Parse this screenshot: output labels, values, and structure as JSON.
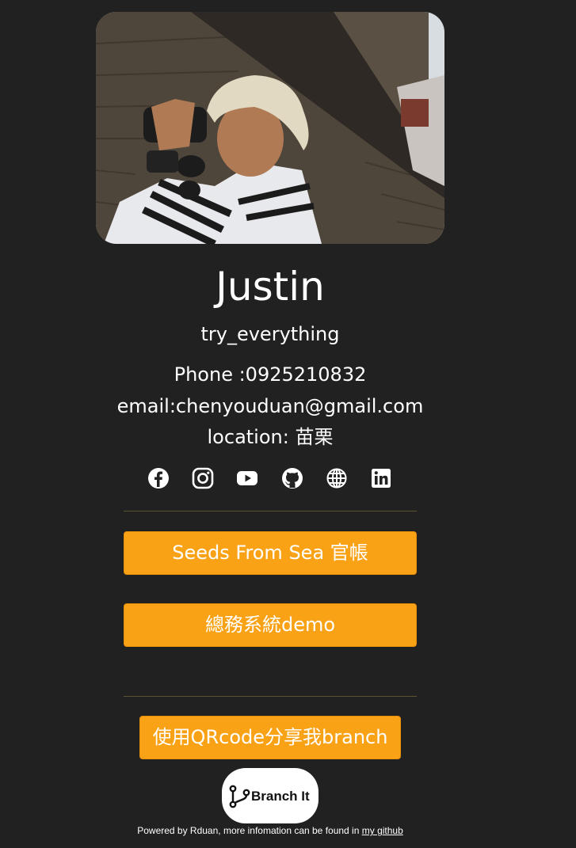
{
  "profile": {
    "name": "Justin",
    "tagline": "try_everything",
    "phone": "Phone :0925210832",
    "email": "email:chenyouduan@gmail.com",
    "location": "location: 苗栗"
  },
  "socials": [
    {
      "icon": "facebook-icon"
    },
    {
      "icon": "instagram-icon"
    },
    {
      "icon": "youtube-icon"
    },
    {
      "icon": "github-icon"
    },
    {
      "icon": "globe-icon"
    },
    {
      "icon": "linkedin-icon"
    }
  ],
  "links": {
    "seeds_label": "Seeds From Sea 官帳",
    "demo_label": "總務系統demo",
    "qr_label": "使用QRcode分享我branch"
  },
  "brand": {
    "logo_text": "Branch It"
  },
  "footer": {
    "text": "Powered by Rduan, more infomation can be found in ",
    "link_label": "my github"
  },
  "colors": {
    "background": "#212121",
    "accent": "#f9a215",
    "divider": "#5e5330",
    "text": "#ffffff"
  }
}
